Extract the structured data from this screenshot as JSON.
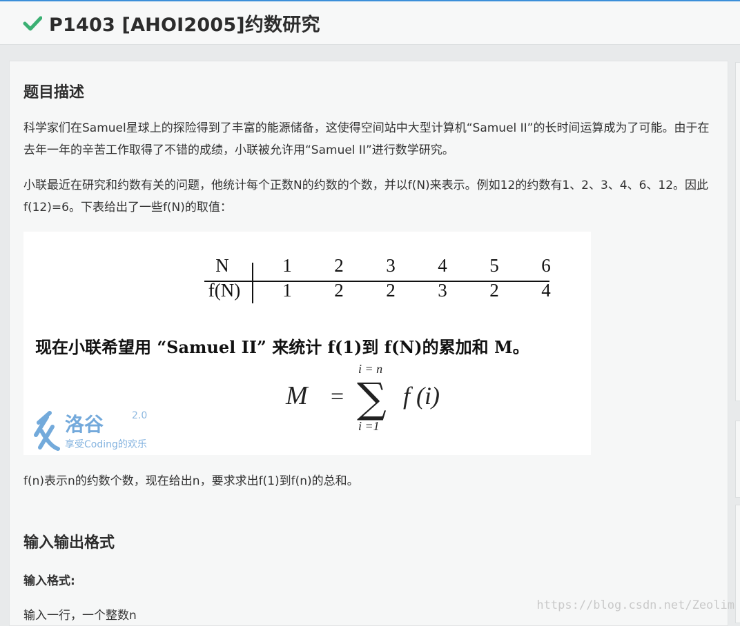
{
  "header": {
    "title": "P1403 [AHOI2005]约数研究",
    "icon": "check-icon",
    "accent": "#3bb073"
  },
  "section1": {
    "heading": "题目描述",
    "para1": "科学家们在Samuel星球上的探险得到了丰富的能源储备，这使得空间站中大型计算机“Samuel II”的长时间运算成为了可能。由于在去年一年的辛苦工作取得了不错的成绩，小联被允许用“Samuel II”进行数学研究。",
    "para2": "小联最近在研究和约数有关的问题，他统计每个正数N的约数的个数，并以f(N)来表示。例如12的约数有1、2、3、4、6、12。因此f(12)=6。下表给出了一些f(N)的取值：",
    "figure": {
      "table_header": [
        "N",
        "1",
        "2",
        "3",
        "4",
        "5",
        "6"
      ],
      "table_row": [
        "f(N)",
        "1",
        "2",
        "2",
        "3",
        "2",
        "4"
      ],
      "sentence": "现在小联希望用 “Samuel II” 来统计 f(1)到 f(N)的累加和 M。",
      "formula": {
        "lhs": "M",
        "eq": "=",
        "sum": "∑",
        "upper": "i = n",
        "lower": "i =1",
        "term": "f (i)"
      },
      "logo": {
        "name": "洛谷",
        "version": "2.0",
        "slogan": "享受Coding的欢乐"
      }
    },
    "para3": "f(n)表示n的约数个数，现在给出n，要求求出f(1)到f(n)的总和。"
  },
  "section2": {
    "heading": "输入输出格式",
    "input_label": "输入格式:",
    "input_text": "输入一行，一个整数n"
  },
  "watermark": "https://blog.csdn.net/Zeolim"
}
